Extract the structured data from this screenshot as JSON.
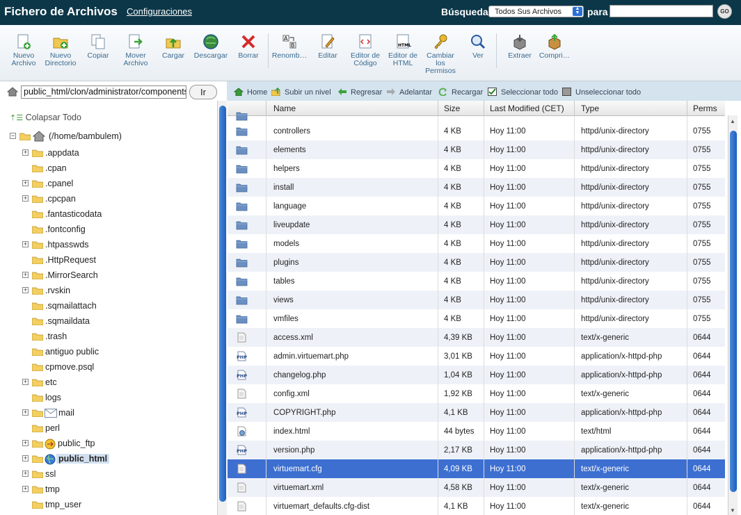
{
  "header": {
    "title": "Fichero de Archivos",
    "settings_link": "Configuraciones",
    "search_label": "Búsqueda",
    "search_scope": "Todos Sus Archivos",
    "for_label": "para",
    "search_value": "",
    "go_label": "GO"
  },
  "toolbar": [
    {
      "label": "Nuevo Archivo",
      "icon": "new-file-icon"
    },
    {
      "label": "Nuevo Directorio",
      "icon": "new-folder-icon"
    },
    {
      "label": "Copiar",
      "icon": "copy-icon"
    },
    {
      "label": "Mover Archivo",
      "icon": "move-icon"
    },
    {
      "label": "Cargar",
      "icon": "upload-icon"
    },
    {
      "label": "Descargar",
      "icon": "download-icon"
    },
    {
      "label": "Borrar",
      "icon": "delete-icon"
    },
    {
      "label": "Renomb…",
      "icon": "rename-icon"
    },
    {
      "label": "Editar",
      "icon": "edit-icon"
    },
    {
      "label": "Editor de Código",
      "icon": "code-editor-icon"
    },
    {
      "label": "Editor de HTML",
      "icon": "html-editor-icon"
    },
    {
      "label": "Cambiar los Permisos",
      "icon": "permissions-icon"
    },
    {
      "label": "Ver",
      "icon": "view-icon"
    },
    {
      "label": "Extraer",
      "icon": "extract-icon"
    },
    {
      "label": "Compri…",
      "icon": "compress-icon"
    }
  ],
  "path": {
    "value": "public_html/clon/administrator/components/com_virtuemart",
    "go_label": "Ir"
  },
  "tree": {
    "collapse_label": "Colapsar Todo",
    "root": "(/home/bambulem)",
    "items": [
      {
        "name": ".appdata",
        "expand": true
      },
      {
        "name": ".cpan",
        "expand": false
      },
      {
        "name": ".cpanel",
        "expand": true
      },
      {
        "name": ".cpcpan",
        "expand": true
      },
      {
        "name": ".fantasticodata",
        "expand": false
      },
      {
        "name": ".fontconfig",
        "expand": false
      },
      {
        "name": ".htpasswds",
        "expand": true
      },
      {
        "name": ".HttpRequest",
        "expand": false
      },
      {
        "name": ".MirrorSearch",
        "expand": true
      },
      {
        "name": ".rvskin",
        "expand": true
      },
      {
        "name": ".sqmailattach",
        "expand": false
      },
      {
        "name": ".sqmaildata",
        "expand": false
      },
      {
        "name": ".trash",
        "expand": false
      },
      {
        "name": "antiguo public",
        "expand": false
      },
      {
        "name": "cpmove.psql",
        "expand": false
      },
      {
        "name": "etc",
        "expand": true
      },
      {
        "name": "logs",
        "expand": false
      },
      {
        "name": "mail",
        "expand": true,
        "icon": "mail-icon"
      },
      {
        "name": "perl",
        "expand": false
      },
      {
        "name": "public_ftp",
        "expand": true,
        "icon": "ftp-icon"
      },
      {
        "name": "public_html",
        "expand": true,
        "icon": "globe-icon",
        "selected": true
      },
      {
        "name": "ssl",
        "expand": true
      },
      {
        "name": "tmp",
        "expand": true
      },
      {
        "name": "tmp_user",
        "expand": false
      }
    ]
  },
  "navbar": [
    {
      "label": "Home",
      "icon": "home-icon"
    },
    {
      "label": "Subir un nivel",
      "icon": "up-level-icon"
    },
    {
      "label": "Regresar",
      "icon": "back-arrow-icon"
    },
    {
      "label": "Adelantar",
      "icon": "forward-arrow-icon"
    },
    {
      "label": "Recargar",
      "icon": "reload-icon"
    },
    {
      "label": "Seleccionar todo",
      "icon": "checkbox-checked-icon"
    },
    {
      "label": "Unseleccionar todo",
      "icon": "checkbox-empty-icon"
    }
  ],
  "columns": [
    "Name",
    "Size",
    "Last Modified (CET)",
    "Type",
    "Perms"
  ],
  "files": [
    {
      "name": "controllers",
      "size": "4 KB",
      "modified": "Hoy 11:00",
      "type": "httpd/unix-directory",
      "perms": "0755",
      "kind": "folder"
    },
    {
      "name": "elements",
      "size": "4 KB",
      "modified": "Hoy 11:00",
      "type": "httpd/unix-directory",
      "perms": "0755",
      "kind": "folder"
    },
    {
      "name": "helpers",
      "size": "4 KB",
      "modified": "Hoy 11:00",
      "type": "httpd/unix-directory",
      "perms": "0755",
      "kind": "folder"
    },
    {
      "name": "install",
      "size": "4 KB",
      "modified": "Hoy 11:00",
      "type": "httpd/unix-directory",
      "perms": "0755",
      "kind": "folder"
    },
    {
      "name": "language",
      "size": "4 KB",
      "modified": "Hoy 11:00",
      "type": "httpd/unix-directory",
      "perms": "0755",
      "kind": "folder"
    },
    {
      "name": "liveupdate",
      "size": "4 KB",
      "modified": "Hoy 11:00",
      "type": "httpd/unix-directory",
      "perms": "0755",
      "kind": "folder"
    },
    {
      "name": "models",
      "size": "4 KB",
      "modified": "Hoy 11:00",
      "type": "httpd/unix-directory",
      "perms": "0755",
      "kind": "folder"
    },
    {
      "name": "plugins",
      "size": "4 KB",
      "modified": "Hoy 11:00",
      "type": "httpd/unix-directory",
      "perms": "0755",
      "kind": "folder"
    },
    {
      "name": "tables",
      "size": "4 KB",
      "modified": "Hoy 11:00",
      "type": "httpd/unix-directory",
      "perms": "0755",
      "kind": "folder"
    },
    {
      "name": "views",
      "size": "4 KB",
      "modified": "Hoy 11:00",
      "type": "httpd/unix-directory",
      "perms": "0755",
      "kind": "folder"
    },
    {
      "name": "vmfiles",
      "size": "4 KB",
      "modified": "Hoy 11:00",
      "type": "httpd/unix-directory",
      "perms": "0755",
      "kind": "folder"
    },
    {
      "name": "access.xml",
      "size": "4,39 KB",
      "modified": "Hoy 11:00",
      "type": "text/x-generic",
      "perms": "0644",
      "kind": "text"
    },
    {
      "name": "admin.virtuemart.php",
      "size": "3,01 KB",
      "modified": "Hoy 11:00",
      "type": "application/x-httpd-php",
      "perms": "0644",
      "kind": "php"
    },
    {
      "name": "changelog.php",
      "size": "1,04 KB",
      "modified": "Hoy 11:00",
      "type": "application/x-httpd-php",
      "perms": "0644",
      "kind": "php"
    },
    {
      "name": "config.xml",
      "size": "1,92 KB",
      "modified": "Hoy 11:00",
      "type": "text/x-generic",
      "perms": "0644",
      "kind": "text"
    },
    {
      "name": "COPYRIGHT.php",
      "size": "4,1 KB",
      "modified": "Hoy 11:00",
      "type": "application/x-httpd-php",
      "perms": "0644",
      "kind": "php"
    },
    {
      "name": "index.html",
      "size": "44 bytes",
      "modified": "Hoy 11:00",
      "type": "text/html",
      "perms": "0644",
      "kind": "html"
    },
    {
      "name": "version.php",
      "size": "2,17 KB",
      "modified": "Hoy 11:00",
      "type": "application/x-httpd-php",
      "perms": "0644",
      "kind": "php"
    },
    {
      "name": "virtuemart.cfg",
      "size": "4,09 KB",
      "modified": "Hoy 11:00",
      "type": "text/x-generic",
      "perms": "0644",
      "kind": "text",
      "selected": true
    },
    {
      "name": "virtuemart.xml",
      "size": "4,58 KB",
      "modified": "Hoy 11:00",
      "type": "text/x-generic",
      "perms": "0644",
      "kind": "text"
    },
    {
      "name": "virtuemart_defaults.cfg-dist",
      "size": "4,1 KB",
      "modified": "Hoy 11:00",
      "type": "text/x-generic",
      "perms": "0644",
      "kind": "text"
    }
  ],
  "colors": {
    "header_bg": "#0c3748",
    "selected_row": "#3d6fd1",
    "nav_bg": "#d4e3ee",
    "folder_blue": "#6a8fc0",
    "folder_yellow": "#f0c850"
  }
}
